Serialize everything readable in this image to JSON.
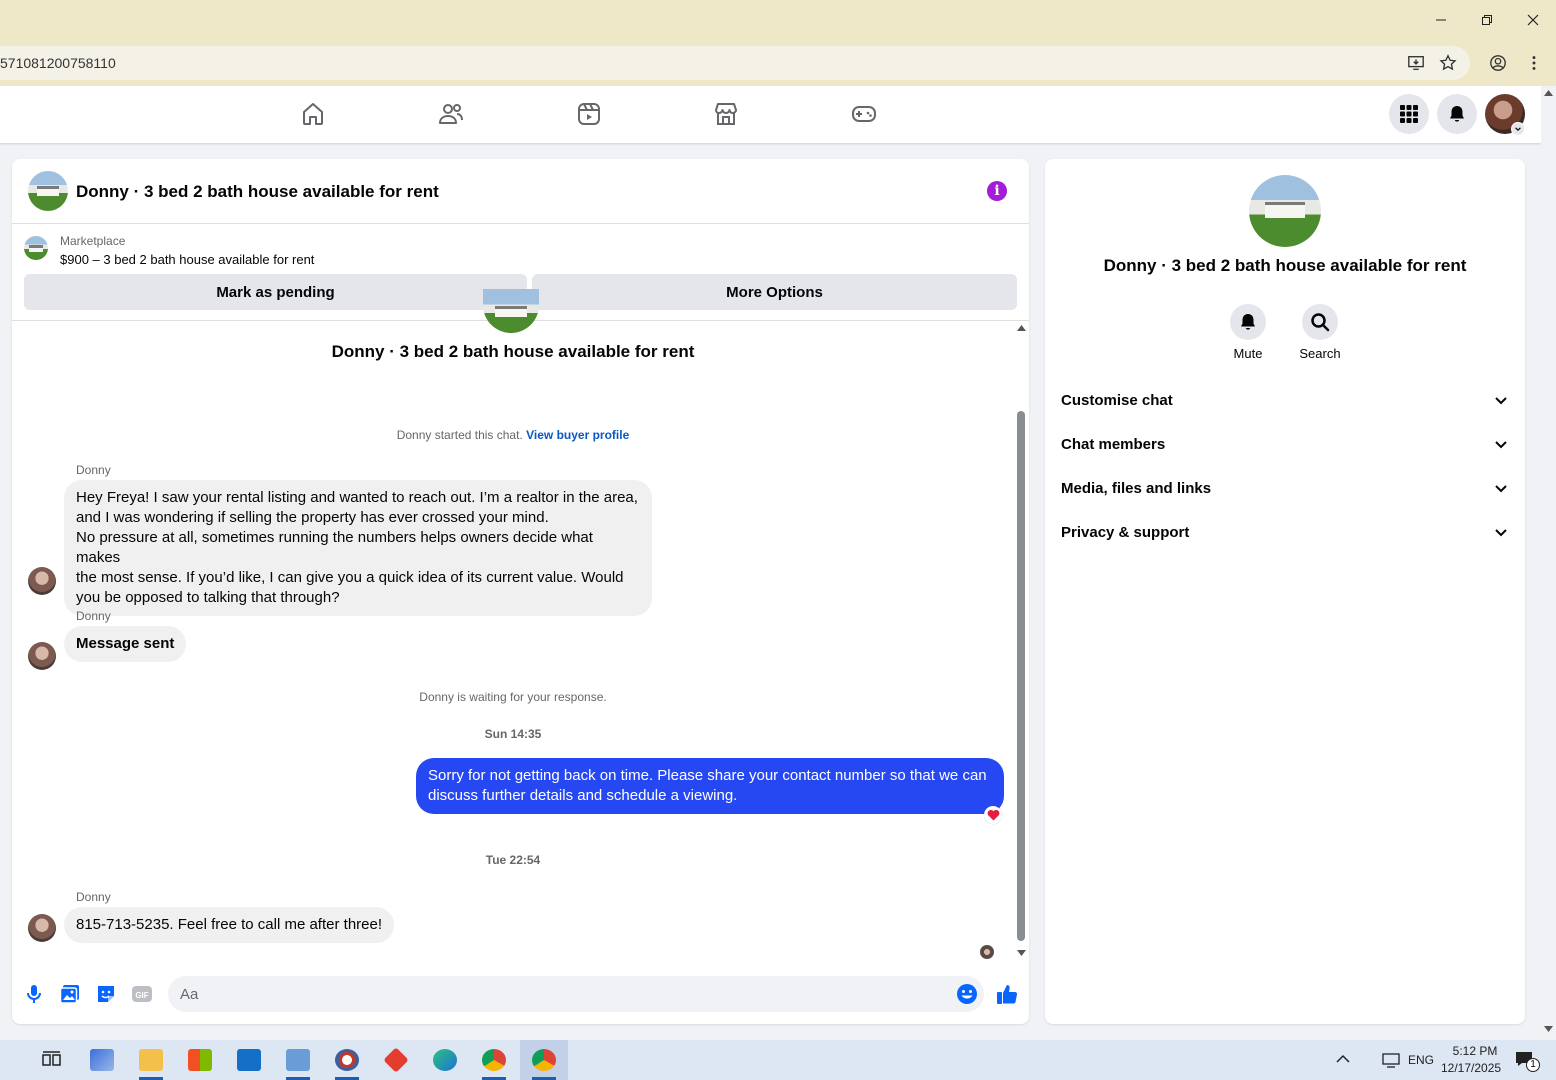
{
  "browser": {
    "url_fragment": "571081200758110"
  },
  "chat": {
    "title": "Donny · 3 bed 2 bath house available for rent",
    "marketplace_label": "Marketplace",
    "listing": "$900 – 3 bed 2 bath house available for rent",
    "mark_pending_label": "Mark as pending",
    "more_options_label": "More Options",
    "conversation_title": "Donny · 3 bed 2 bath house available for rent",
    "started_text": "Donny started this chat.",
    "view_buyer_label": "View buyer profile",
    "messages": [
      {
        "sender": "Donny",
        "text_lines": [
          "Hey Freya! I saw your rental listing and wanted to reach out. I’m a realtor in the area,",
          "and I was wondering if selling the property has ever crossed your mind.",
          "No pressure at all, sometimes running the numbers helps owners decide what makes",
          "the most sense. If you’d like, I can give you a quick idea of its current value. Would",
          "you be opposed to talking that through?"
        ]
      },
      {
        "sender": "Donny",
        "text": "Message sent"
      },
      {
        "sender": "Donny",
        "text": "815-713-5235. Feel free to call me after three!"
      }
    ],
    "waiting_text": "Donny is waiting for your response.",
    "timestamp_1": "Sun 14:35",
    "outgoing_lines": [
      "Sorry for not getting back on time. Please share your contact number so that we can",
      "discuss further details and schedule a viewing."
    ],
    "timestamp_2": "Tue 22:54",
    "input_placeholder": "Aa"
  },
  "side": {
    "title": "Donny · 3 bed 2 bath house available for rent",
    "mute_label": "Mute",
    "search_label": "Search",
    "sections": [
      "Customise chat",
      "Chat members",
      "Media, files and links",
      "Privacy & support"
    ]
  },
  "taskbar": {
    "lang": "ENG",
    "time": "5:12 PM",
    "date": "12/17/2025",
    "notif_count": "1"
  },
  "colors": {
    "accent_blue": "#2548f2",
    "fb_blue": "#0866ff",
    "info_purple": "#a41cd6",
    "titlebar": "#efe8c8"
  }
}
